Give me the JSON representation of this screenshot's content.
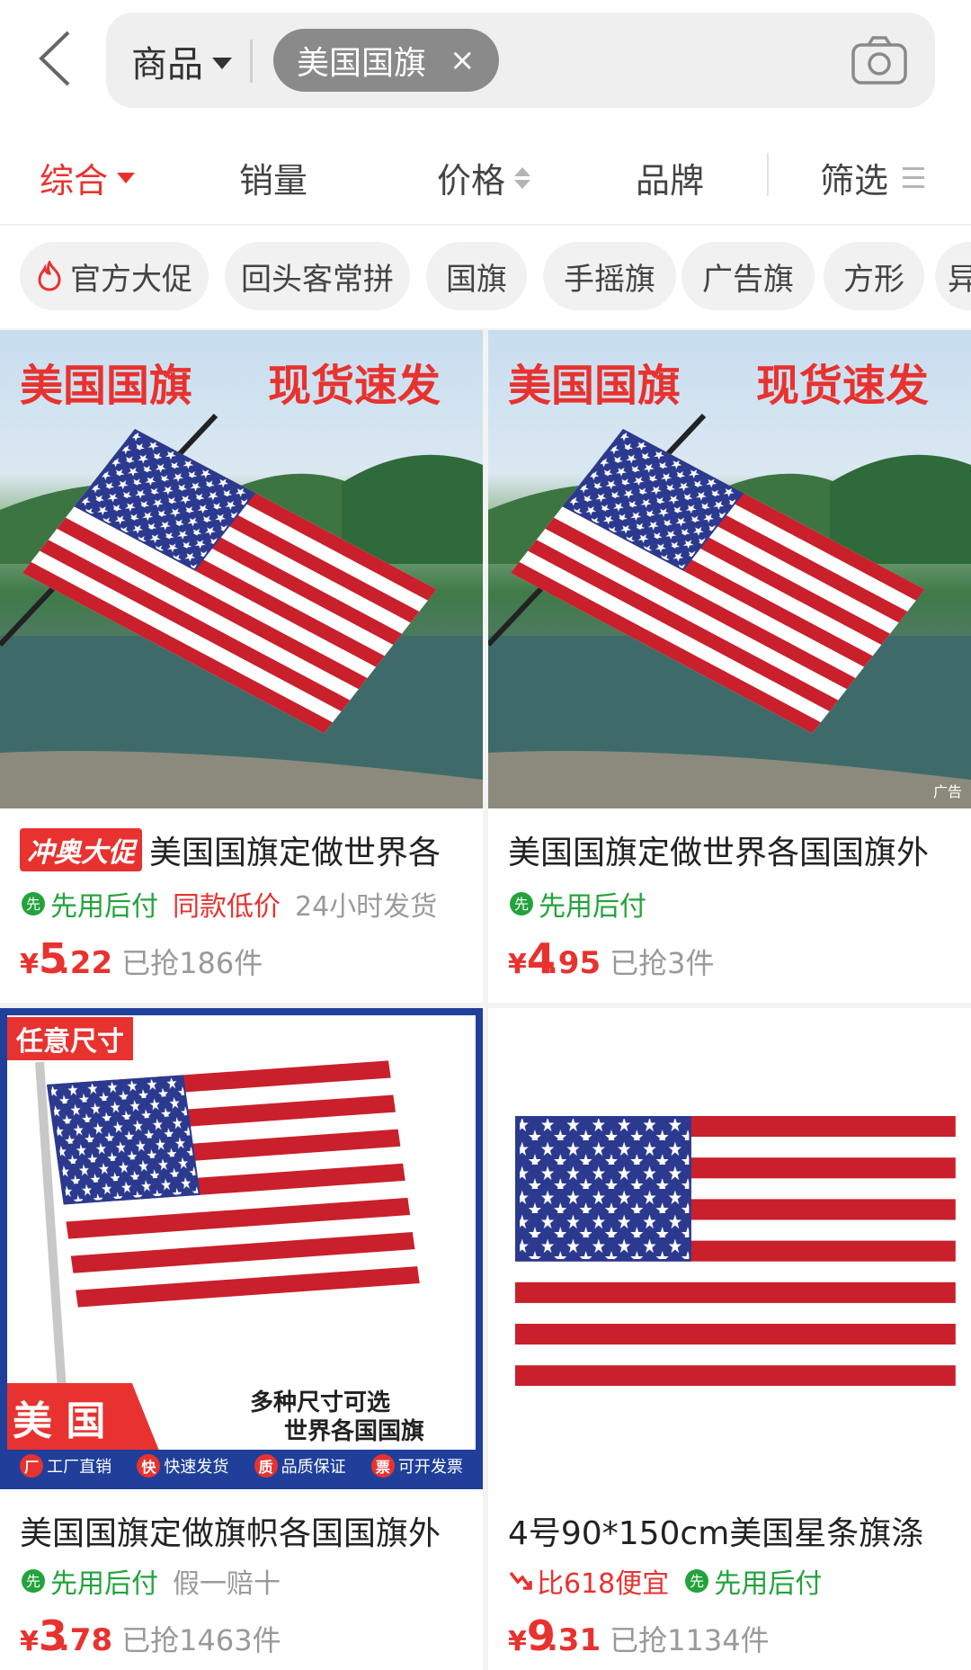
{
  "search": {
    "scope": "商品",
    "query_chip": "美国国旗",
    "chip_close": "×"
  },
  "sort": {
    "items": [
      "综合",
      "销量",
      "价格",
      "品牌",
      "筛选"
    ]
  },
  "tags": [
    "官方大促",
    "回头客常拼",
    "国旗",
    "手摇旗",
    "广告旗",
    "方形",
    "异"
  ],
  "products": [
    {
      "image_text_left": "美国国旗",
      "image_text_right": "现货速发",
      "promo_badge": "冲奥大促",
      "title": "美国国旗定做世界各",
      "tags": [
        "先用后付",
        "同款低价",
        "24小时发货"
      ],
      "yen": "¥",
      "price_int": "5",
      "price_dec": ".22",
      "sold": "已抢186件"
    },
    {
      "image_text_left": "美国国旗",
      "image_text_right": "现货速发",
      "ad_label": "广告",
      "title": "美国国旗定做世界各国国旗外",
      "tags": [
        "先用后付"
      ],
      "yen": "¥",
      "price_int": "4",
      "price_dec": ".95",
      "sold": "已抢3件"
    },
    {
      "image_badge": "任意尺寸",
      "image_country": "美 国",
      "image_caption_1": "多种尺寸可选",
      "image_caption_2": "世界各国国旗",
      "image_features": [
        {
          "icon": "厂",
          "text": "工厂直销"
        },
        {
          "icon": "快",
          "text": "快速发货"
        },
        {
          "icon": "质",
          "text": "品质保证"
        },
        {
          "icon": "票",
          "text": "可开发票"
        }
      ],
      "title": "美国国旗定做旗帜各国国旗外",
      "tags": [
        "先用后付",
        "假一赔十"
      ],
      "yen": "¥",
      "price_int": "3",
      "price_dec": ".78",
      "sold": "已抢1463件"
    },
    {
      "title": "4号90*150cm美国星条旗涤",
      "tags": [
        "比618便宜",
        "先用后付"
      ],
      "yen": "¥",
      "price_int": "9",
      "price_dec": ".31",
      "sold": "已抢1134件"
    }
  ],
  "colors": {
    "accent_red": "#e8322f",
    "green": "#22a33b",
    "flag_blue": "#2b3a8f",
    "flag_red": "#c9202c"
  }
}
